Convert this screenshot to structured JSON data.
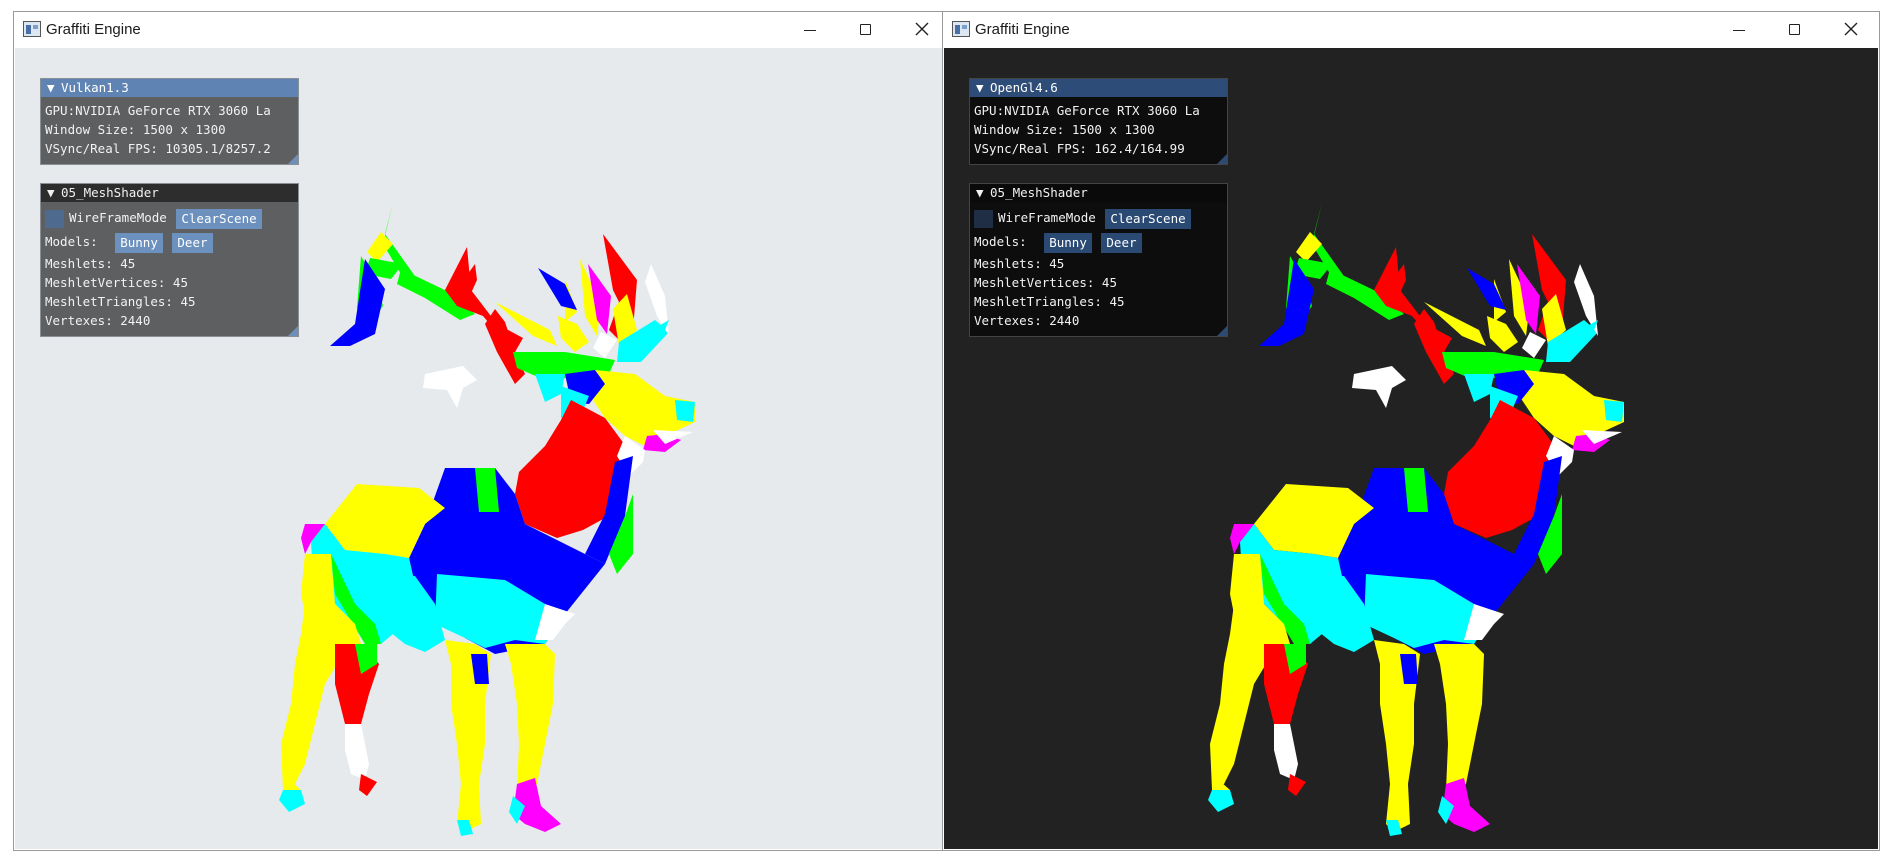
{
  "windows": [
    {
      "title": "Graffiti Engine",
      "theme": "light",
      "stats_panel": {
        "header": "Vulkan1.3",
        "gpu": "GPU:NVIDIA GeForce RTX 3060 La",
        "window_size": "Window Size: 1500 x 1300",
        "fps": "VSync/Real FPS: 10305.1/8257.2"
      },
      "mesh_panel": {
        "header": "05_MeshShader",
        "wireframe_label": "WireFrameMode",
        "clear_scene_label": "ClearScene",
        "models_label": "Models:",
        "model_buttons": [
          "Bunny",
          "Deer"
        ],
        "meshlets": "Meshlets: 45",
        "meshlet_vertices": "MeshletVertices: 45",
        "meshlet_triangles": "MeshletTriangles: 45",
        "vertexes": "Vertexes: 2440"
      }
    },
    {
      "title": "Graffiti Engine",
      "theme": "dark",
      "stats_panel": {
        "header": "OpenGl4.6",
        "gpu": "GPU:NVIDIA GeForce RTX 3060 La",
        "window_size": "Window Size: 1500 x 1300",
        "fps": "VSync/Real FPS: 162.4/164.99"
      },
      "mesh_panel": {
        "header": "05_MeshShader",
        "wireframe_label": "WireFrameMode",
        "clear_scene_label": "ClearScene",
        "models_label": "Models:",
        "model_buttons": [
          "Bunny",
          "Deer"
        ],
        "meshlets": "Meshlets: 45",
        "meshlet_vertices": "MeshletVertices: 45",
        "meshlet_triangles": "MeshletTriangles: 45",
        "vertexes": "Vertexes: 2440"
      }
    }
  ],
  "colors": {
    "light_viewport": "#e6eaec",
    "dark_viewport": "#222222",
    "meshlet_palette": [
      "#ffff00",
      "#0000ff",
      "#ff0000",
      "#00ffff",
      "#00ff00",
      "#ff00ff",
      "#ffffff"
    ]
  },
  "icons": {
    "app": "app-window-icon",
    "minimize": "minimize-icon",
    "maximize": "maximize-icon",
    "close": "close-icon",
    "collapse": "triangle-down-icon"
  }
}
